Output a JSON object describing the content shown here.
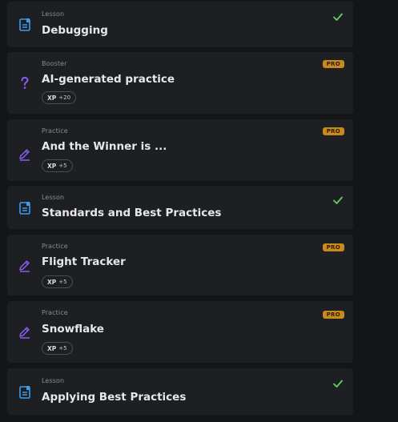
{
  "items": [
    {
      "type": "Lesson",
      "title": "Debugging",
      "icon": "lesson-document-icon",
      "completed": true
    },
    {
      "type": "Booster",
      "title": "AI-generated practice",
      "icon": "question-mark-icon",
      "pro": "PRO",
      "xp_label": "XP",
      "xp_value": "+20"
    },
    {
      "type": "Practice",
      "title": "And the Winner is ...",
      "icon": "practice-pencil-icon",
      "pro": "PRO",
      "xp_label": "XP",
      "xp_value": "+5"
    },
    {
      "type": "Lesson",
      "title": "Standards and Best Practices",
      "icon": "lesson-document-icon",
      "completed": true
    },
    {
      "type": "Practice",
      "title": "Flight Tracker",
      "icon": "practice-pencil-icon",
      "pro": "PRO",
      "xp_label": "XP",
      "xp_value": "+5"
    },
    {
      "type": "Practice",
      "title": "Snowflake",
      "icon": "practice-pencil-icon",
      "pro": "PRO",
      "xp_label": "XP",
      "xp_value": "+5"
    },
    {
      "type": "Lesson",
      "title": "Applying Best Practices",
      "icon": "lesson-document-icon",
      "completed": true
    }
  ],
  "colors": {
    "background": "#141517",
    "card": "#1d1f22",
    "lesson_icon": "#3d9bf0",
    "practice_icon": "#8a5cf0",
    "check": "#5fd15f",
    "pro_badge": "#c98a1c"
  }
}
